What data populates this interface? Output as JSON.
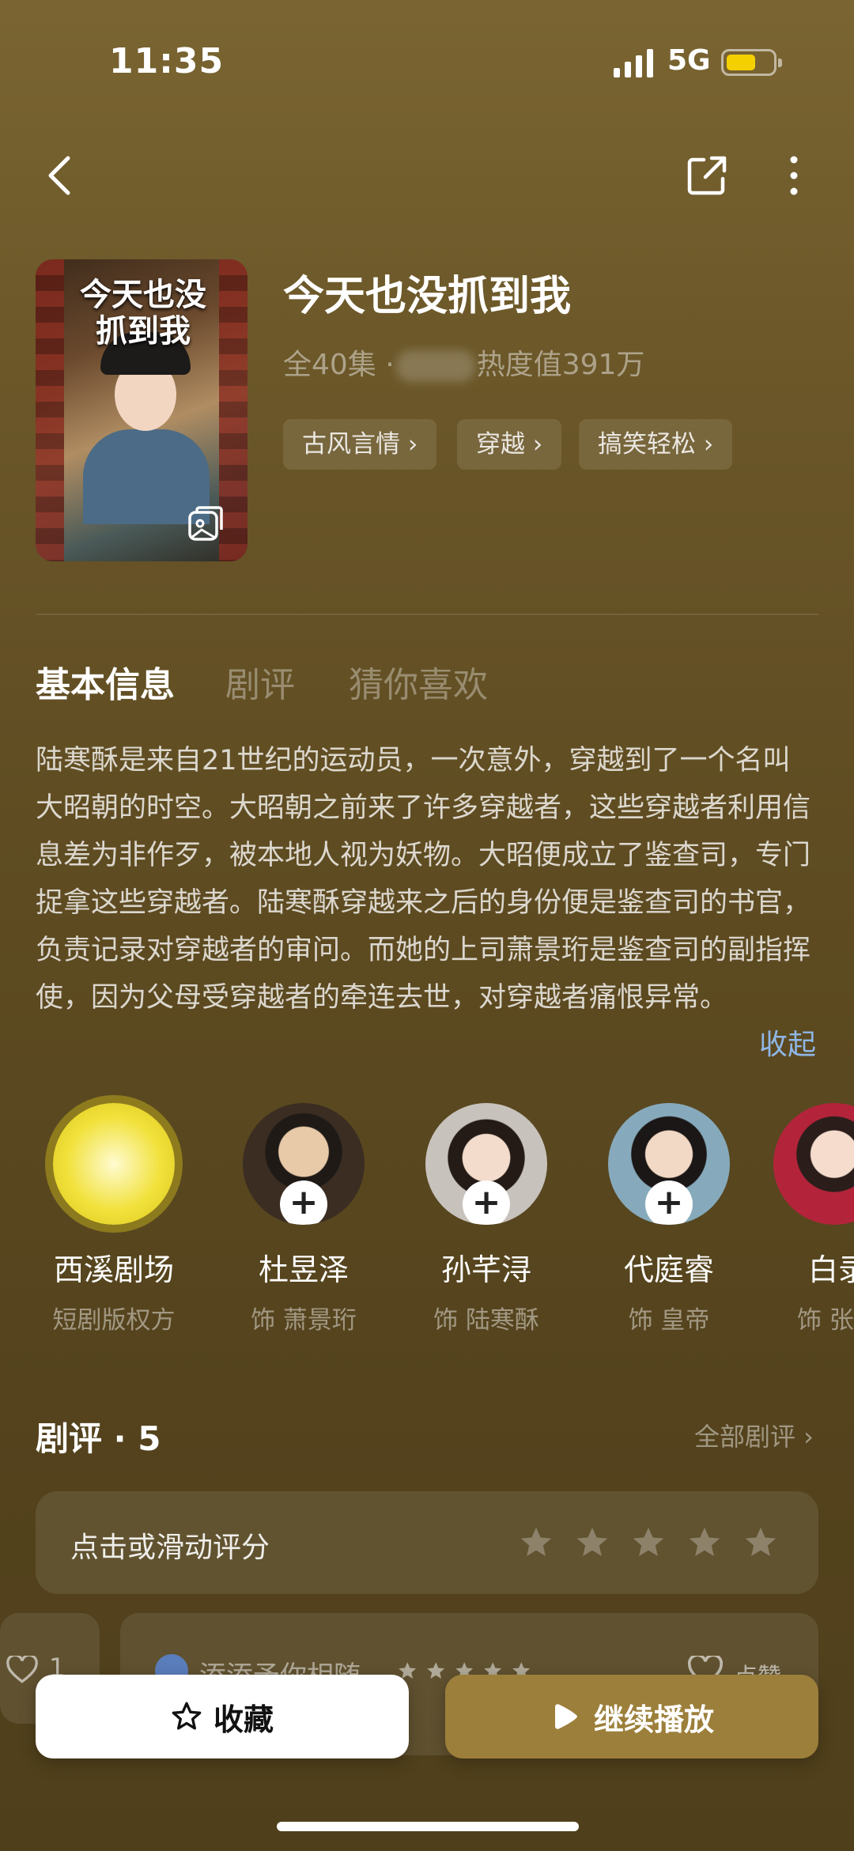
{
  "status_bar": {
    "time": "11:35",
    "network": "5G"
  },
  "drama": {
    "title": "今天也没抓到我",
    "poster_title_line1": "今天也没",
    "poster_title_line2": "抓到我",
    "episodes": "全40集 ·",
    "heat": "热度值391万",
    "tags": [
      "古风言情 ›",
      "穿越 ›",
      "搞笑轻松 ›"
    ]
  },
  "tabs": [
    "基本信息",
    "剧评",
    "猜你喜欢"
  ],
  "synopsis": "陆寒酥是来自21世纪的运动员，一次意外，穿越到了一个名叫大昭朝的时空。大昭朝之前来了许多穿越者，这些穿越者利用信息差为非作歹，被本地人视为妖物。大昭便成立了鉴查司，专门捉拿这些穿越者。陆寒酥穿越来之后的身份便是鉴查司的书官，负责记录对穿越者的审问。而她的上司萧景珩是鉴查司的副指挥使，因为父母受穿越者的牵连去世，对穿越者痛恨异常。",
  "collapse_label": "收起",
  "cast": [
    {
      "name": "西溪剧场",
      "role": "短剧版权方"
    },
    {
      "name": "杜昱泽",
      "role": "饰 萧景珩"
    },
    {
      "name": "孙芊浔",
      "role": "饰 陆寒酥"
    },
    {
      "name": "代庭睿",
      "role": "饰 皇帝"
    },
    {
      "name": "白录",
      "role": "饰 张"
    }
  ],
  "reviews": {
    "title": "剧评 · 5",
    "all_label": "全部剧评 ›",
    "rating_prompt": "点击或滑动评分",
    "partial_like_count": "1",
    "first_user": "添添予你相随",
    "like_label": "点赞"
  },
  "bottom_bar": {
    "collect_label": "收藏",
    "play_label": "继续播放"
  },
  "colors": {
    "accent_gold": "#9c7f3a",
    "collapse_blue": "#8fb7e6",
    "battery_yellow": "#f5d000"
  }
}
